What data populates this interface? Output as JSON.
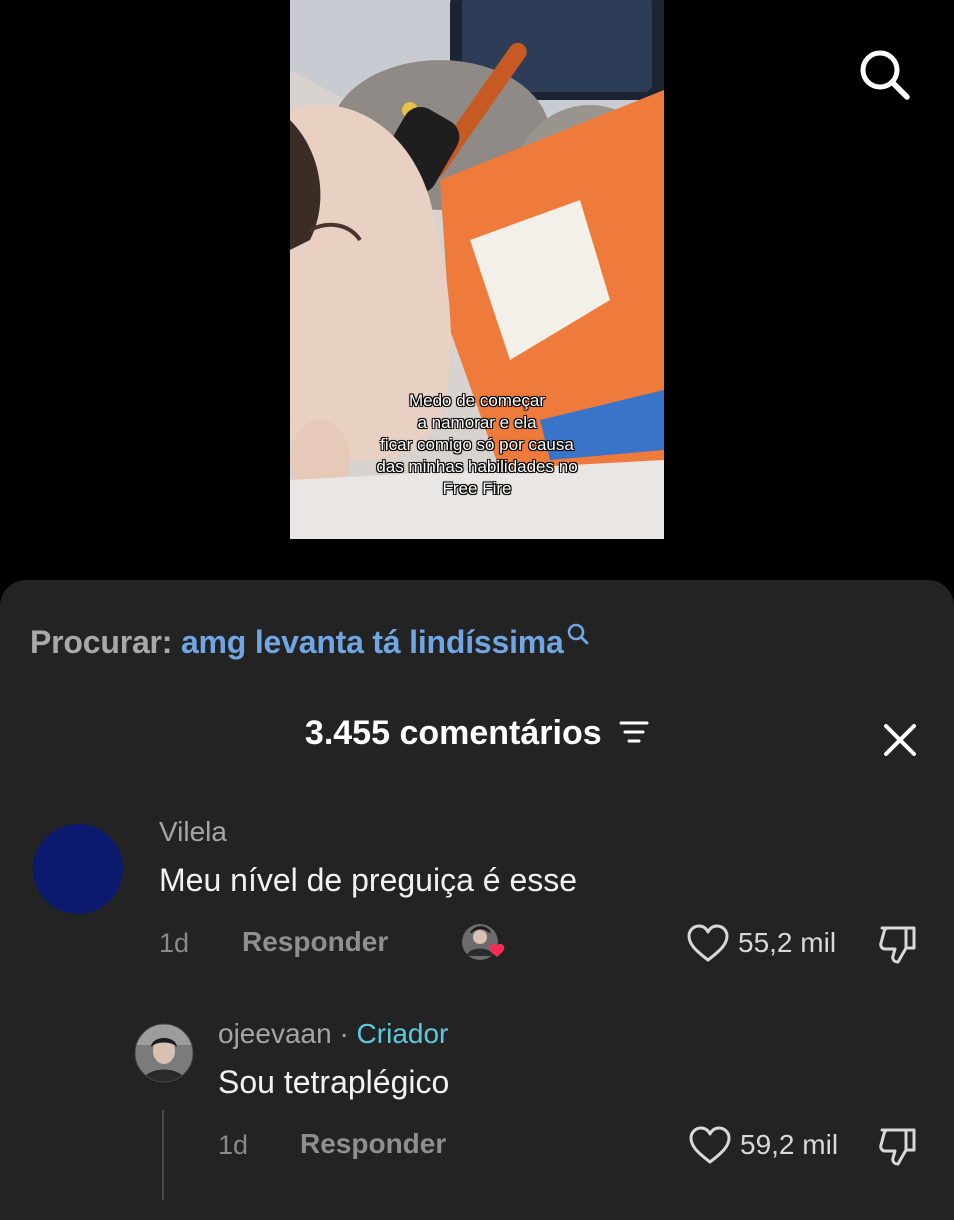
{
  "video": {
    "caption_lines": [
      "Medo de começar",
      "a namorar e ela",
      "ficar comigo só por causa",
      "das minhas habilidades no",
      "Free Fire"
    ]
  },
  "top_bar": {
    "search_icon": "search-icon"
  },
  "search_suggestion": {
    "prefix": "Procurar:",
    "query": "amg levanta tá lindíssima"
  },
  "comments_header": {
    "title": "3.455 comentários",
    "filter_icon": "filter-icon",
    "close_icon": "close-icon"
  },
  "comments": [
    {
      "username": "Vilela",
      "text": "Meu nível de preguiça é esse",
      "time": "1d",
      "reply_label": "Responder",
      "likes": "55,2 mil",
      "avatar_color": "#0b1a6e",
      "creator_liked": true
    },
    {
      "username": "ojeevaan",
      "separator": "·",
      "badge": "Criador",
      "text": "Sou tetraplégico",
      "time": "1d",
      "reply_label": "Responder",
      "likes": "59,2 mil"
    }
  ],
  "colors": {
    "sheet_bg": "#232323",
    "link_blue": "#6fa6e3",
    "creator_badge": "#5cc9df",
    "heart_red": "#fe2c55"
  }
}
